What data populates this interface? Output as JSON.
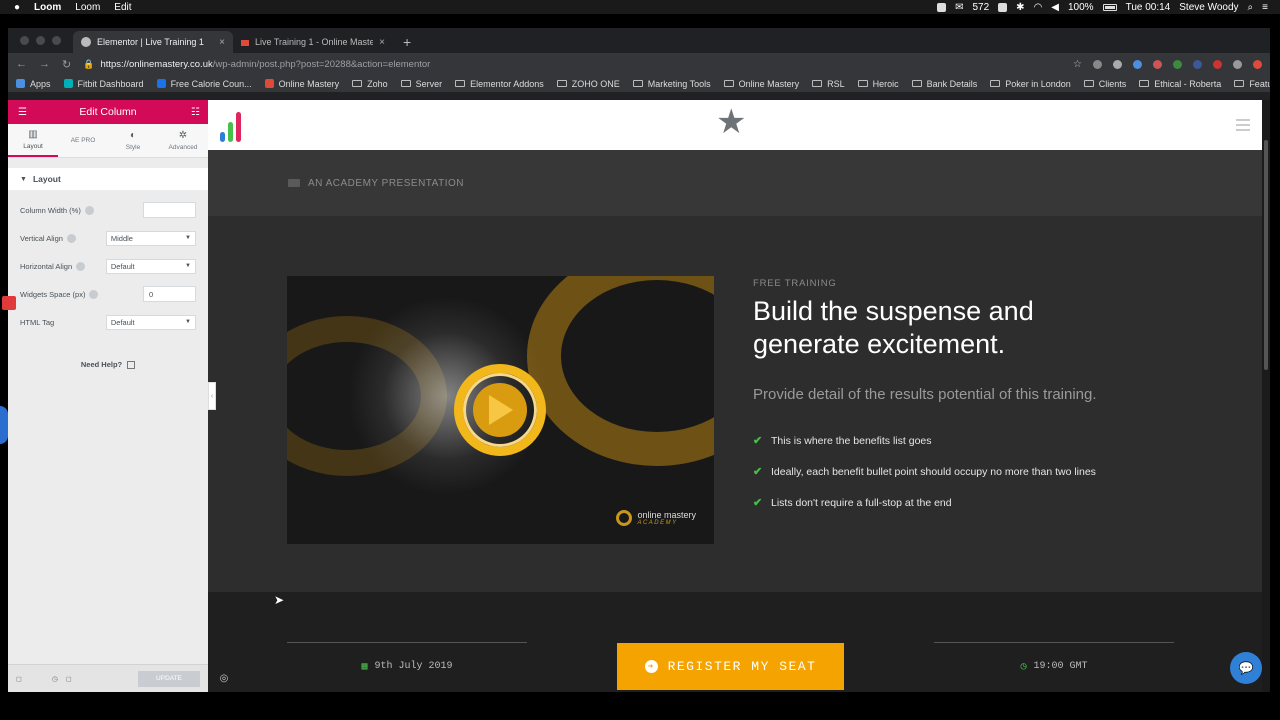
{
  "menubar": {
    "app": "Loom",
    "items": [
      "Loom",
      "Edit"
    ],
    "battery": "100%",
    "count": "572",
    "time": "Tue 00:14",
    "user": "Steve Woody"
  },
  "browser": {
    "tabs": [
      {
        "title": "Elementor | Live Training 1",
        "close": "×"
      },
      {
        "title": "Live Training 1 - Online Master",
        "close": "×"
      }
    ],
    "new_tab": "+",
    "url_host": "https://onlinemastery.co.uk",
    "url_path": "/wp-admin/post.php?post=20288&action=elementor",
    "bookmarks": [
      "Apps",
      "Fitbit Dashboard",
      "Free Calorie Coun...",
      "Online Mastery",
      "Zoho",
      "Server",
      "Elementor Addons",
      "ZOHO ONE",
      "Marketing Tools",
      "Online Mastery",
      "RSL",
      "Heroic",
      "Bank Details",
      "Poker in London",
      "Clients",
      "Ethical - Roberta",
      "Featured In"
    ],
    "more": "»"
  },
  "panel": {
    "title": "Edit Column",
    "tabs": [
      {
        "label": "Layout",
        "icon": "▥"
      },
      {
        "label": "AE PRO",
        "icon": ""
      },
      {
        "label": "Style",
        "icon": "◐"
      },
      {
        "label": "Advanced",
        "icon": "✲"
      }
    ],
    "section": "Layout",
    "controls": [
      {
        "label": "Column Width (%)",
        "value": ""
      },
      {
        "label": "Vertical Align",
        "value": "Middle"
      },
      {
        "label": "Horizontal Align",
        "value": "Default"
      },
      {
        "label": "Widgets Space (px)",
        "value": "0"
      },
      {
        "label": "HTML Tag",
        "value": "Default"
      }
    ],
    "help": "Need Help?",
    "update": "UPDATE"
  },
  "site": {
    "presentation": "AN ACADEMY PRESENTATION",
    "kicker": "FREE TRAINING",
    "headline_1": "Build the suspense and",
    "headline_2": "generate excitement.",
    "subtitle": "Provide detail of the results potential of this training.",
    "benefits": [
      "This is where the benefits list goes",
      "Ideally, each benefit bullet point should occupy no more than two lines",
      "Lists don't require a full-stop at the end"
    ],
    "video_logo_1": "online mastery",
    "video_logo_2": "ACADEMY",
    "date": "9th July 2019",
    "cta": "REGISTER MY SEAT",
    "time": "19:00 GMT"
  },
  "colors": {
    "accent": "#d20a58",
    "cta": "#f5a300",
    "gold": "#f2b81b",
    "tick": "#47c04a"
  }
}
